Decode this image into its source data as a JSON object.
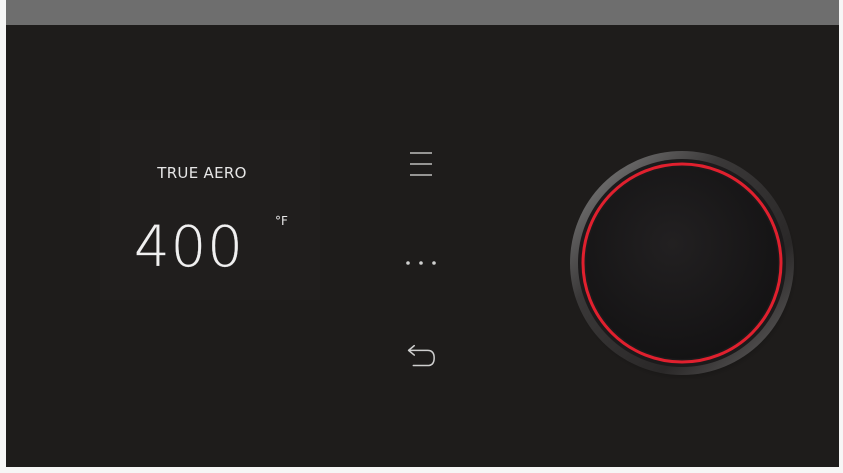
{
  "display": {
    "mode": "TRUE AERO",
    "temperature": "400",
    "unit": "°F"
  },
  "controls": {
    "menu_icon": "menu-lines-icon",
    "more_icon": "ellipsis-icon",
    "back_icon": "back-arrow-icon"
  },
  "knob": {
    "ring_color": "#e0202e",
    "body_color": "#1a1819"
  },
  "colors": {
    "panel": "#1e1c1b",
    "text": "#e6e6e6",
    "icon": "#bdbdbd"
  }
}
